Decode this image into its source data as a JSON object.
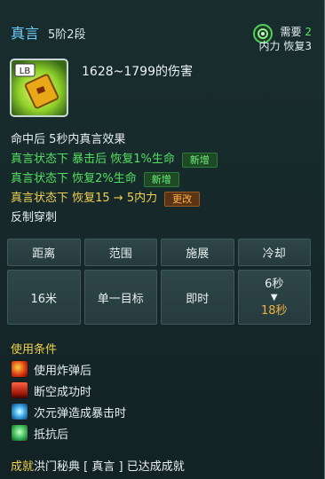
{
  "skill": {
    "name": "真言",
    "rank": "5阶2段",
    "icon_key_label": "LB",
    "damage": "1628~1799的伤害"
  },
  "requirement": {
    "label": "需要",
    "amount": "2",
    "resource": "内力 恢复3"
  },
  "effects": [
    {
      "text": "命中后 5秒内真言效果",
      "color": "white"
    },
    {
      "text": "真言状态下 暴击后 恢复1%生命",
      "color": "green",
      "badge": "新增"
    },
    {
      "text": "真言状态下 恢复2%生命",
      "color": "green",
      "badge": "新增"
    },
    {
      "text": "真言状态下 恢复15 → 5内力",
      "color": "yellow",
      "badge": "更改"
    },
    {
      "text": "反制穿刺",
      "color": "white"
    }
  ],
  "stats": {
    "headers": [
      "距离",
      "范围",
      "施展",
      "冷却"
    ],
    "values": [
      "16米",
      "单一目标",
      "即时"
    ],
    "cooldown": {
      "old": "6秒",
      "arrow": "▼",
      "new": "18秒"
    }
  },
  "conditions": {
    "title": "使用条件",
    "items": [
      {
        "label": "使用炸弹后",
        "icon": "bomb-skill-icon"
      },
      {
        "label": "断空成功时",
        "icon": "break-skill-icon"
      },
      {
        "label": "次元弹造成暴击时",
        "icon": "dimension-orb-icon"
      },
      {
        "label": "抵抗后",
        "icon": "resist-skill-icon"
      }
    ]
  },
  "achievement": {
    "prefix": "成就",
    "text": "洪门秘典 [ 真言 ] 已达成成就"
  },
  "colors": {
    "title": "#6fd0ff",
    "green": "#54e060",
    "yellow": "#f0d050",
    "cooldown_new": "#f0b040"
  }
}
